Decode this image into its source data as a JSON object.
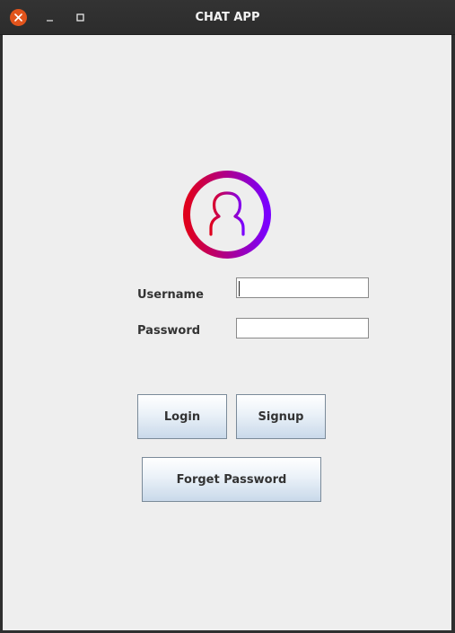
{
  "window": {
    "title": "CHAT APP",
    "close_icon": "close-icon",
    "minimize_icon": "minimize-icon",
    "maximize_icon": "maximize-icon"
  },
  "avatar": {
    "icon": "user-icon",
    "gradient_start": "#e0001b",
    "gradient_end": "#7a00ff"
  },
  "form": {
    "username_label": "Username",
    "username_value": "",
    "password_label": "Password",
    "password_value": ""
  },
  "buttons": {
    "login": "Login",
    "signup": "Signup",
    "forget_password": "Forget Password"
  }
}
